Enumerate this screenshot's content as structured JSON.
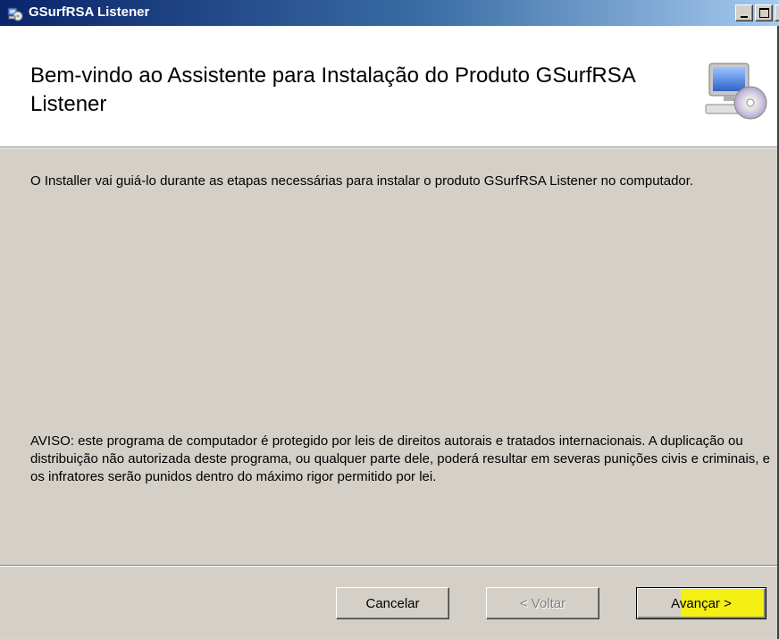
{
  "window": {
    "title": "GSurfRSA Listener",
    "caption_buttons": {
      "minimize": "_",
      "maximize": "□",
      "close": "×"
    }
  },
  "header": {
    "title": "Bem-vindo ao Assistente para Instalação do Produto GSurfRSA Listener",
    "icon": "computer-cd-icon"
  },
  "body": {
    "intro": "O Installer vai guiá-lo durante as etapas necessárias para instalar o produto GSurfRSA Listener no computador.",
    "warning": "AVISO: este programa de computador é protegido por leis de direitos autorais e tratados internacionais. A duplicação ou distribuição não autorizada deste programa, ou qualquer parte dele, poderá resultar em severas punições civis e criminais, e os infratores serão punidos dentro do máximo rigor permitido por lei."
  },
  "buttons": {
    "cancel": "Cancelar",
    "back": "< Voltar",
    "next": "Avançar >"
  },
  "colors": {
    "dialog_face": "#d4d0c8",
    "title_bar": "#0a246a",
    "highlight": "#f7f200"
  }
}
